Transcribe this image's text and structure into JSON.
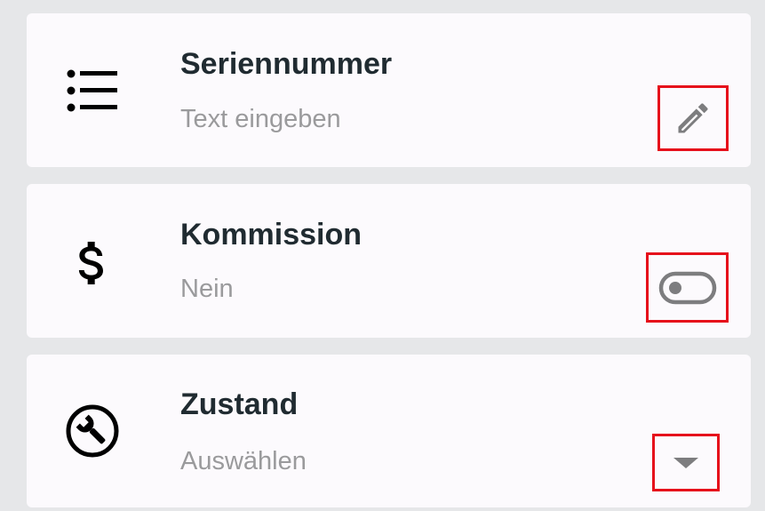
{
  "fields": [
    {
      "title": "Seriennummer",
      "value": "Text eingeben",
      "icon": "list-icon",
      "action_icon": "pencil-icon",
      "action_type": "text-input"
    },
    {
      "title": "Kommission",
      "value": "Nein",
      "icon": "dollar-icon",
      "action_icon": "toggle-icon",
      "action_type": "toggle",
      "toggle_on": false
    },
    {
      "title": "Zustand",
      "value": "Auswählen",
      "icon": "wrench-icon",
      "action_icon": "dropdown-arrow-icon",
      "action_type": "select"
    }
  ],
  "colors": {
    "background": "#e6e7e9",
    "card": "#fcfafd",
    "title": "#202b31",
    "subtitle": "#9a9a9c",
    "highlight": "#e60f1b",
    "icon_gray": "#7d7d7f"
  }
}
